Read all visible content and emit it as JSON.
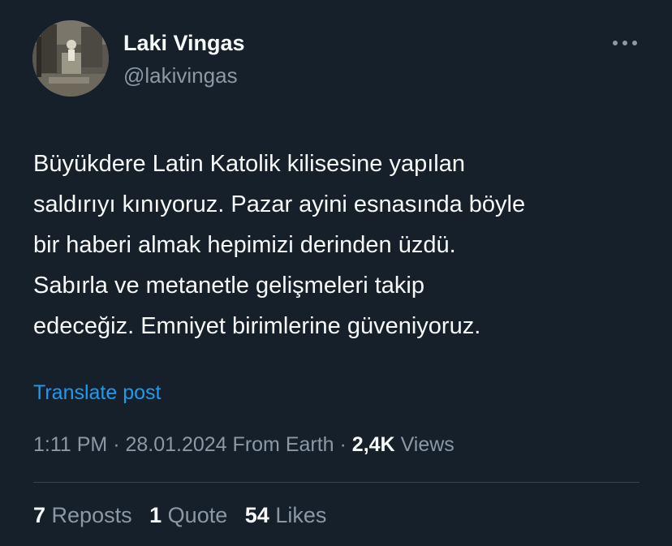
{
  "author": {
    "display_name": "Laki Vingas",
    "handle": "@lakivingas",
    "avatar_icon": "profile-photo"
  },
  "tweet": {
    "lines": [
      "Büyükdere Latin Katolik kilisesine yapılan",
      "saldırıyı kınıyoruz. Pazar ayini esnasında böyle",
      "bir haberi almak hepimizi derinden üzdü.",
      "Sabırla ve metanetle gelişmeleri takip",
      "edeceğiz. Emniyet birimlerine güveniyoruz."
    ],
    "translate_label": "Translate post"
  },
  "meta": {
    "time": "1:11 PM",
    "sep1": " · ",
    "date": "28.01.2024",
    "source": "From Earth",
    "sep2": " · ",
    "views_count": "2,4K",
    "views_label": "Views"
  },
  "stats": {
    "reposts_count": "7",
    "reposts_label": "Reposts",
    "quotes_count": "1",
    "quotes_label": "Quote",
    "likes_count": "54",
    "likes_label": "Likes"
  },
  "colors": {
    "background": "#15202b",
    "text_primary": "#f7f9f9",
    "text_secondary": "#8b98a5",
    "link": "#1d9bf0",
    "divider": "#38444d"
  }
}
